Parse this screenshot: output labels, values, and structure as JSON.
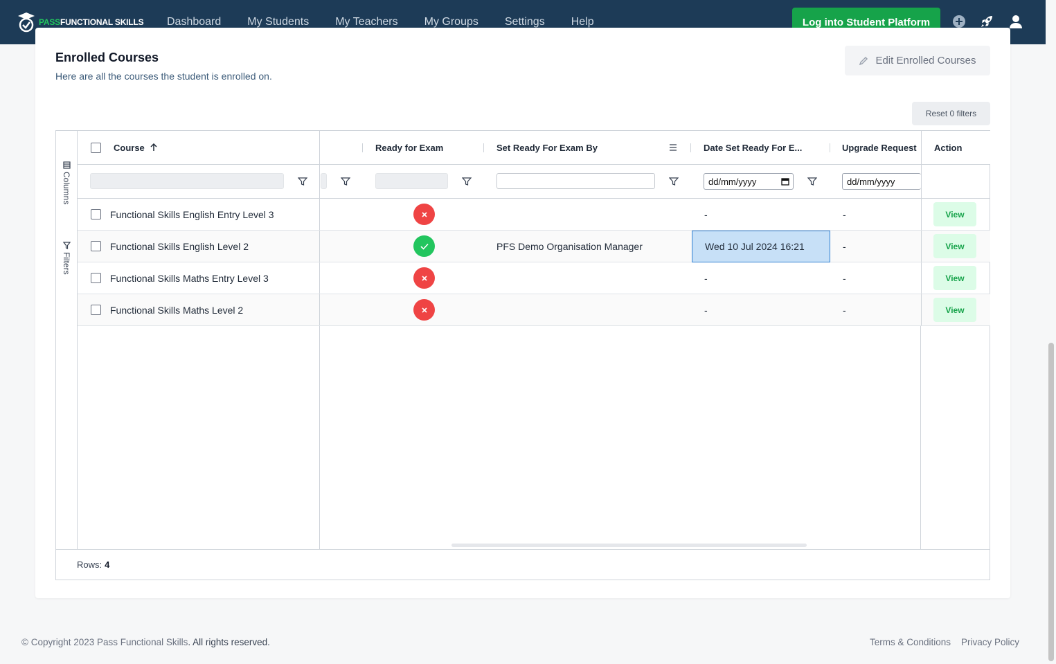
{
  "brand": {
    "pass": "PASS",
    "rest": "FUNCTIONAL SKILLS"
  },
  "nav": {
    "links": [
      "Dashboard",
      "My Students",
      "My Teachers",
      "My Groups",
      "Settings",
      "Help"
    ],
    "login_button": "Log into Student Platform"
  },
  "section": {
    "title": "Enrolled Courses",
    "subtitle": "Here are all the courses the student is enrolled on.",
    "edit_button": "Edit Enrolled Courses",
    "reset_filters": "Reset 0 filters"
  },
  "grid": {
    "side_tabs": {
      "columns": "Columns",
      "filters": "Filters"
    },
    "headers": {
      "course": "Course",
      "ready_for_exam": "Ready for Exam",
      "set_by": "Set Ready For Exam By",
      "date_set": "Date Set Ready For E...",
      "upgrade": "Upgrade Request",
      "action": "Action"
    },
    "date_placeholder": "dd/mm/yyyy",
    "rows": [
      {
        "course": "Functional Skills English Entry Level 3",
        "ready": false,
        "set_by": "",
        "date_set": "-",
        "upgrade": "-",
        "action": "View"
      },
      {
        "course": "Functional Skills English Level 2",
        "ready": true,
        "set_by": "PFS Demo Organisation Manager",
        "date_set": "Wed 10 Jul 2024 16:21",
        "upgrade": "-",
        "action": "View"
      },
      {
        "course": "Functional Skills Maths Entry Level 3",
        "ready": false,
        "set_by": "",
        "date_set": "-",
        "upgrade": "-",
        "action": "View"
      },
      {
        "course": "Functional Skills Maths Level 2",
        "ready": false,
        "set_by": "",
        "date_set": "-",
        "upgrade": "-",
        "action": "View"
      }
    ],
    "rows_label": "Rows:",
    "rows_count": "4"
  },
  "footer": {
    "copyright_prefix": "© Copyright 2023",
    "company": "Pass Functional Skills",
    "rights": ". All rights reserved.",
    "terms": "Terms & Conditions",
    "privacy": "Privacy Policy"
  },
  "colors": {
    "nav_bg": "#1d3b57",
    "accent_green": "#16a34a",
    "error_red": "#ef4444",
    "success_green": "#22c55e",
    "selection_blue": "#c7e0f7"
  }
}
